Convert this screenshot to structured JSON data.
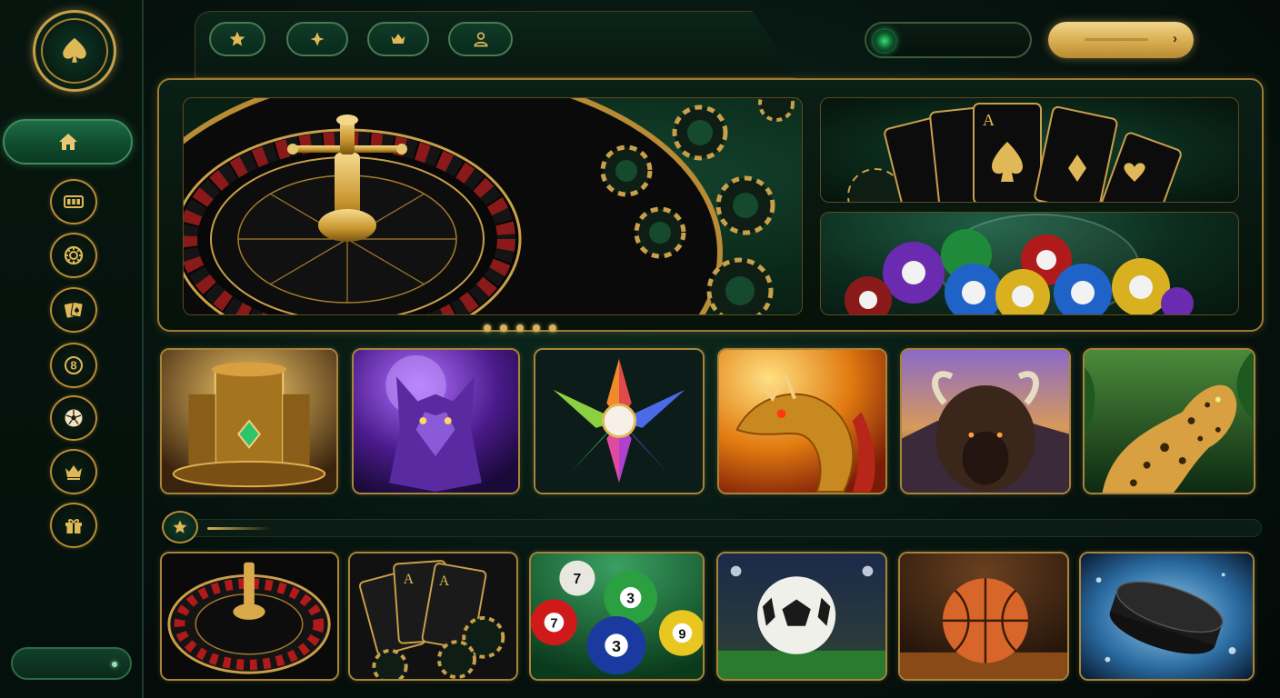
{
  "sidebar": {
    "logo_icon": "spade-icon",
    "home_icon": "home-icon",
    "items": [
      {
        "name": "slots",
        "icon": "slot-reels-icon"
      },
      {
        "name": "roulette",
        "icon": "roulette-chip-icon"
      },
      {
        "name": "cards",
        "icon": "playing-cards-icon"
      },
      {
        "name": "lottery",
        "icon": "eight-ball-icon",
        "glyph": "8"
      },
      {
        "name": "sports",
        "icon": "soccer-ball-icon"
      },
      {
        "name": "vip",
        "icon": "crown-icon"
      },
      {
        "name": "bonus",
        "icon": "gift-icon"
      }
    ]
  },
  "topbar": {
    "icons": [
      "star-icon",
      "diamond-icon",
      "crown-icon",
      "user-icon"
    ],
    "balance_text": "",
    "cta_icon": "chevron-right-icon",
    "cta_glyph": "›"
  },
  "hero": {
    "main": {
      "subject": "roulette-wheel"
    },
    "panels": [
      {
        "subject": "playing-cards"
      },
      {
        "subject": "lottery-balls"
      }
    ],
    "dots_count": 5
  },
  "games_row_1": [
    {
      "theme": "golden-temple"
    },
    {
      "theme": "purple-wolf"
    },
    {
      "theme": "rainbow-gem-star"
    },
    {
      "theme": "golden-dragon"
    },
    {
      "theme": "buffalo"
    },
    {
      "theme": "jungle-leopard"
    }
  ],
  "section": {
    "icon": "star-icon"
  },
  "games_row_2": [
    {
      "theme": "roulette"
    },
    {
      "theme": "blackjack-cards"
    },
    {
      "theme": "billiard-balls",
      "labels": [
        "7",
        "3",
        "7",
        "3",
        "9"
      ]
    },
    {
      "theme": "football"
    },
    {
      "theme": "basketball"
    },
    {
      "theme": "ice-hockey-puck"
    }
  ],
  "colors": {
    "gold": "#d4ab52",
    "dark_green": "#0a2418",
    "accent_green": "#1e6b45"
  }
}
